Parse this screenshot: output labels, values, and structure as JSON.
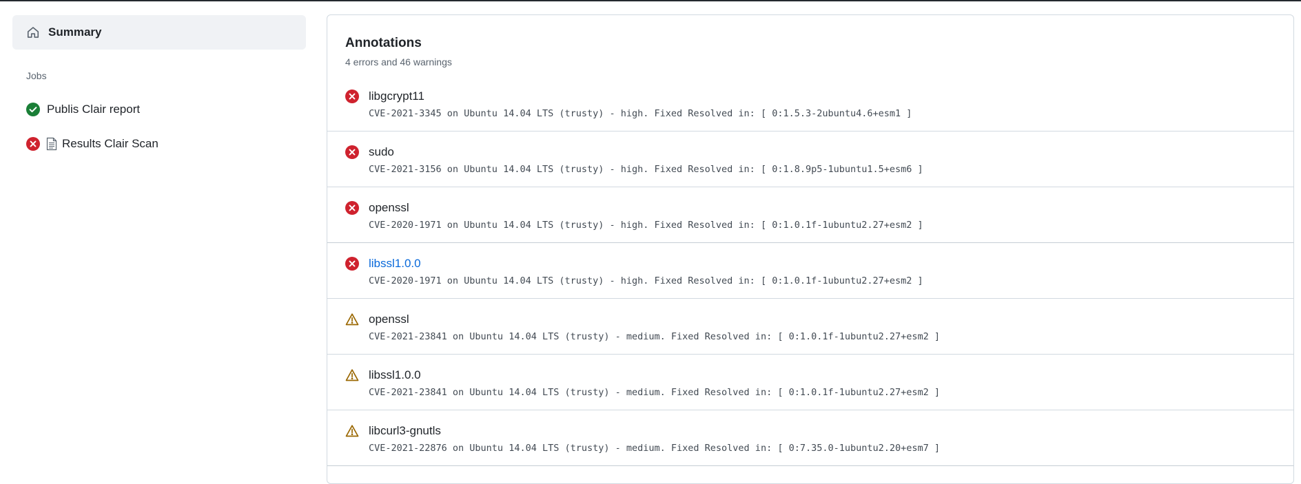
{
  "sidebar": {
    "summary_label": "Summary",
    "jobs_heading": "Jobs",
    "jobs": [
      {
        "label": "Publis Clair report",
        "status": "success"
      },
      {
        "label": "Results Clair Scan",
        "status": "failure"
      }
    ]
  },
  "annotations": {
    "title": "Annotations",
    "subtitle": "4 errors and 46 warnings",
    "items": [
      {
        "level": "error",
        "name": "libgcrypt11",
        "message": "CVE-2021-3345 on Ubuntu 14.04 LTS (trusty) - high. Fixed Resolved in: [ 0:1.5.3-2ubuntu4.6+esm1 ]"
      },
      {
        "level": "error",
        "name": "sudo",
        "message": "CVE-2021-3156 on Ubuntu 14.04 LTS (trusty) - high. Fixed Resolved in: [ 0:1.8.9p5-1ubuntu1.5+esm6 ]"
      },
      {
        "level": "error",
        "name": "openssl",
        "message": "CVE-2020-1971 on Ubuntu 14.04 LTS (trusty) - high. Fixed Resolved in: [ 0:1.0.1f-1ubuntu2.27+esm2 ]"
      },
      {
        "level": "error",
        "name": "libssl1.0.0",
        "message": "CVE-2020-1971 on Ubuntu 14.04 LTS (trusty) - high. Fixed Resolved in: [ 0:1.0.1f-1ubuntu2.27+esm2 ]"
      },
      {
        "level": "warning",
        "name": "openssl",
        "message": "CVE-2021-23841 on Ubuntu 14.04 LTS (trusty) - medium. Fixed Resolved in: [ 0:1.0.1f-1ubuntu2.27+esm2 ]"
      },
      {
        "level": "warning",
        "name": "libssl1.0.0",
        "message": "CVE-2021-23841 on Ubuntu 14.04 LTS (trusty) - medium. Fixed Resolved in: [ 0:1.0.1f-1ubuntu2.27+esm2 ]"
      },
      {
        "level": "warning",
        "name": "libcurl3-gnutls",
        "message": "CVE-2021-22876 on Ubuntu 14.04 LTS (trusty) - medium. Fixed Resolved in: [ 0:7.35.0-1ubuntu2.20+esm7 ]"
      }
    ]
  },
  "colors": {
    "error": "#cf222e",
    "warning": "#9a6700",
    "success": "#1a7f37",
    "link": "#0969da"
  },
  "icons": {
    "summary": "home-icon",
    "success": "check-circle-icon",
    "failure": "x-circle-icon",
    "job_file": "file-icon",
    "error": "x-circle-icon",
    "warning": "alert-triangle-icon"
  }
}
